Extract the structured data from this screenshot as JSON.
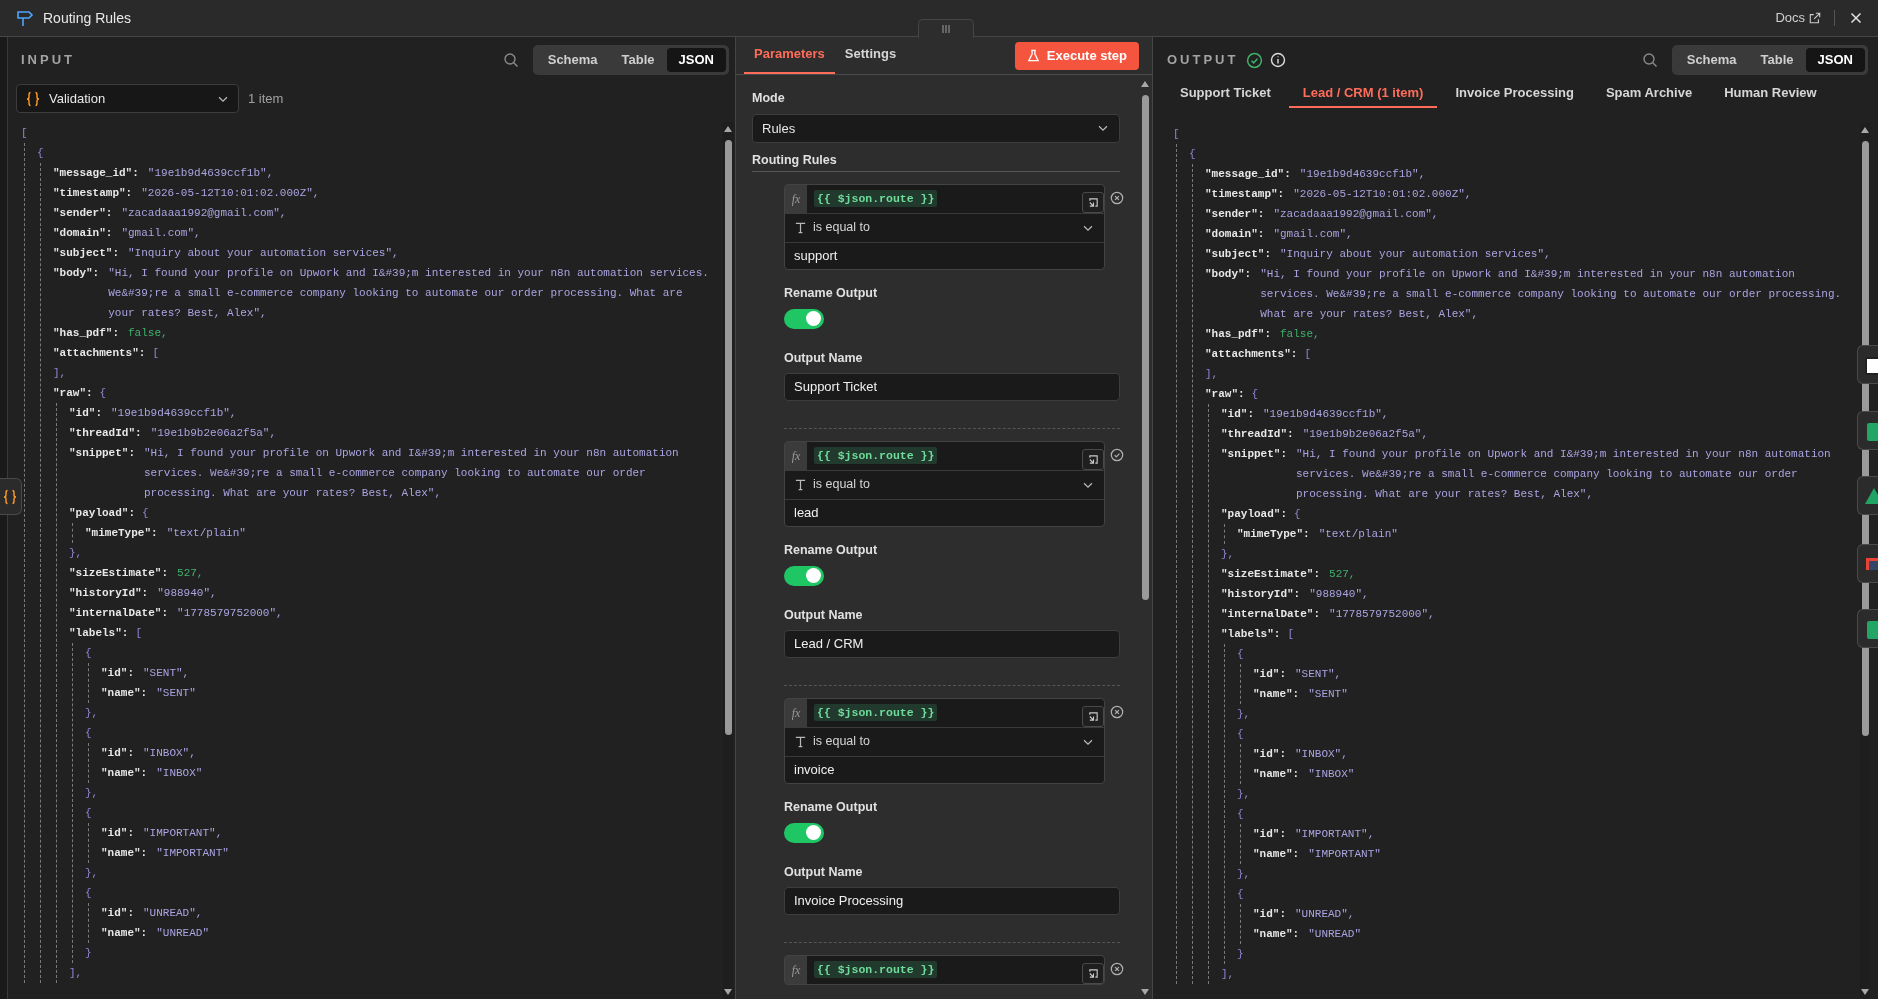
{
  "window": {
    "title": "Routing Rules",
    "docs_link": "Docs"
  },
  "input": {
    "label": "INPUT",
    "view_modes": [
      {
        "label": "Schema",
        "selected": false
      },
      {
        "label": "Table",
        "selected": false
      },
      {
        "label": "JSON",
        "selected": true
      }
    ],
    "source": "Validation",
    "item_count": "1 item",
    "json_tree": [
      {
        "open": "[",
        "children": [
          {
            "open": "{",
            "children": [
              {
                "key": "\"message_id\":",
                "value": "\"19e1b9d4639ccf1b\",",
                "kind": "string"
              },
              {
                "key": "\"timestamp\":",
                "value": "\"2026-05-12T10:01:02.000Z\",",
                "kind": "string"
              },
              {
                "key": "\"sender\":",
                "value": "\"zacadaaa1992@gmail.com\",",
                "kind": "string"
              },
              {
                "key": "\"domain\":",
                "value": "\"gmail.com\",",
                "kind": "string"
              },
              {
                "key": "\"subject\":",
                "value": "\"Inquiry about your automation services\",",
                "kind": "string"
              },
              {
                "key": "\"body\":",
                "value": "\"Hi, I found your profile on Upwork and I&#39;m interested in your n8n automation services. We&#39;re a small e-commerce company looking to automate our order processing. What are your rates? Best, Alex\",",
                "kind": "string"
              },
              {
                "key": "\"has_pdf\":",
                "value": "false,",
                "kind": "literal"
              },
              {
                "key": "\"attachments\":",
                "open": "[",
                "close": "],"
              },
              {
                "key": "\"raw\":",
                "open": "{",
                "children": [
                  {
                    "key": "\"id\":",
                    "value": "\"19e1b9d4639ccf1b\",",
                    "kind": "string"
                  },
                  {
                    "key": "\"threadId\":",
                    "value": "\"19e1b9b2e06a2f5a\",",
                    "kind": "string"
                  },
                  {
                    "key": "\"snippet\":",
                    "value": "\"Hi, I found your profile on Upwork and I&#39;m interested in your n8n automation services. We&#39;re a small e-commerce company looking to automate our order processing. What are your rates? Best, Alex\",",
                    "kind": "string"
                  },
                  {
                    "key": "\"payload\":",
                    "open": "{",
                    "children": [
                      {
                        "key": "\"mimeType\":",
                        "value": "\"text/plain\"",
                        "kind": "string"
                      }
                    ],
                    "close": "},"
                  },
                  {
                    "key": "\"sizeEstimate\":",
                    "value": "527,",
                    "kind": "literal"
                  },
                  {
                    "key": "\"historyId\":",
                    "value": "\"988940\",",
                    "kind": "string"
                  },
                  {
                    "key": "\"internalDate\":",
                    "value": "\"1778579752000\",",
                    "kind": "string"
                  },
                  {
                    "key": "\"labels\":",
                    "open": "[",
                    "children": [
                      {
                        "open": "{",
                        "children": [
                          {
                            "key": "\"id\":",
                            "value": "\"SENT\",",
                            "kind": "string"
                          },
                          {
                            "key": "\"name\":",
                            "value": "\"SENT\"",
                            "kind": "string"
                          }
                        ],
                        "close": "},"
                      },
                      {
                        "open": "{",
                        "children": [
                          {
                            "key": "\"id\":",
                            "value": "\"INBOX\",",
                            "kind": "string"
                          },
                          {
                            "key": "\"name\":",
                            "value": "\"INBOX\"",
                            "kind": "string"
                          }
                        ],
                        "close": "},"
                      },
                      {
                        "open": "{",
                        "children": [
                          {
                            "key": "\"id\":",
                            "value": "\"IMPORTANT\",",
                            "kind": "string"
                          },
                          {
                            "key": "\"name\":",
                            "value": "\"IMPORTANT\"",
                            "kind": "string"
                          }
                        ],
                        "close": "},"
                      },
                      {
                        "open": "{",
                        "children": [
                          {
                            "key": "\"id\":",
                            "value": "\"UNREAD\",",
                            "kind": "string"
                          },
                          {
                            "key": "\"name\":",
                            "value": "\"UNREAD\"",
                            "kind": "string"
                          }
                        ],
                        "close": "}"
                      }
                    ],
                    "close": "],"
                  }
                ]
              }
            ]
          }
        ]
      }
    ]
  },
  "parameters": {
    "tabs": [
      {
        "label": "Parameters",
        "selected": true
      },
      {
        "label": "Settings",
        "selected": false
      }
    ],
    "execute_button": "Execute step",
    "mode_label": "Mode",
    "mode": "Rules",
    "rules_heading": "Routing Rules",
    "rules": [
      {
        "fx": "fx",
        "expression": "{{ $json.route }}",
        "operator": "is equal to",
        "value": "support",
        "rename_label": "Rename Output",
        "rename_on": true,
        "output_name_label": "Output Name",
        "output_name": "Support Ticket",
        "kind": "remove"
      },
      {
        "fx": "fx",
        "expression": "{{ $json.route }}",
        "operator": "is equal to",
        "value": "lead",
        "rename_label": "Rename Output",
        "rename_on": true,
        "output_name_label": "Output Name",
        "output_name": "Lead / CRM",
        "kind": "confirm"
      },
      {
        "fx": "fx",
        "expression": "{{ $json.route }}",
        "operator": "is equal to",
        "value": "invoice",
        "rename_label": "Rename Output",
        "rename_on": true,
        "output_name_label": "Output Name",
        "output_name": "Invoice Processing",
        "kind": "remove"
      },
      {
        "fx": "fx",
        "expression": "{{ $json.route }}",
        "kind": "remove"
      }
    ]
  },
  "output": {
    "label": "OUTPUT",
    "success": true,
    "view_modes": [
      {
        "label": "Schema",
        "selected": false
      },
      {
        "label": "Table",
        "selected": false
      },
      {
        "label": "JSON",
        "selected": true
      }
    ],
    "branches": [
      {
        "label": "Support Ticket",
        "selected": false
      },
      {
        "label": "Lead / CRM (1 item)",
        "selected": true
      },
      {
        "label": "Invoice Processing",
        "selected": false
      },
      {
        "label": "Spam Archive",
        "selected": false
      },
      {
        "label": "Human Review",
        "selected": false
      }
    ],
    "json_tree": [
      {
        "open": "[",
        "children": [
          {
            "open": "{",
            "children": [
              {
                "key": "\"message_id\":",
                "value": "\"19e1b9d4639ccf1b\",",
                "kind": "string"
              },
              {
                "key": "\"timestamp\":",
                "value": "\"2026-05-12T10:01:02.000Z\",",
                "kind": "string"
              },
              {
                "key": "\"sender\":",
                "value": "\"zacadaaa1992@gmail.com\",",
                "kind": "string"
              },
              {
                "key": "\"domain\":",
                "value": "\"gmail.com\",",
                "kind": "string"
              },
              {
                "key": "\"subject\":",
                "value": "\"Inquiry about your automation services\",",
                "kind": "string"
              },
              {
                "key": "\"body\":",
                "value": "\"Hi, I found your profile on Upwork and I&#39;m interested in your n8n automation services. We&#39;re a small e-commerce company looking to automate our order processing. What are your rates? Best, Alex\",",
                "kind": "string"
              },
              {
                "key": "\"has_pdf\":",
                "value": "false,",
                "kind": "literal"
              },
              {
                "key": "\"attachments\":",
                "open": "[",
                "close": "],"
              },
              {
                "key": "\"raw\":",
                "open": "{",
                "children": [
                  {
                    "key": "\"id\":",
                    "value": "\"19e1b9d4639ccf1b\",",
                    "kind": "string"
                  },
                  {
                    "key": "\"threadId\":",
                    "value": "\"19e1b9b2e06a2f5a\",",
                    "kind": "string"
                  },
                  {
                    "key": "\"snippet\":",
                    "value": "\"Hi, I found your profile on Upwork and I&#39;m interested in your n8n automation services. We&#39;re a small e-commerce company looking to automate our order processing. What are your rates? Best, Alex\",",
                    "kind": "string"
                  },
                  {
                    "key": "\"payload\":",
                    "open": "{",
                    "children": [
                      {
                        "key": "\"mimeType\":",
                        "value": "\"text/plain\"",
                        "kind": "string"
                      }
                    ],
                    "close": "},"
                  },
                  {
                    "key": "\"sizeEstimate\":",
                    "value": "527,",
                    "kind": "literal"
                  },
                  {
                    "key": "\"historyId\":",
                    "value": "\"988940\",",
                    "kind": "string"
                  },
                  {
                    "key": "\"internalDate\":",
                    "value": "\"1778579752000\",",
                    "kind": "string"
                  },
                  {
                    "key": "\"labels\":",
                    "open": "[",
                    "children": [
                      {
                        "open": "{",
                        "children": [
                          {
                            "key": "\"id\":",
                            "value": "\"SENT\",",
                            "kind": "string"
                          },
                          {
                            "key": "\"name\":",
                            "value": "\"SENT\"",
                            "kind": "string"
                          }
                        ],
                        "close": "},"
                      },
                      {
                        "open": "{",
                        "children": [
                          {
                            "key": "\"id\":",
                            "value": "\"INBOX\",",
                            "kind": "string"
                          },
                          {
                            "key": "\"name\":",
                            "value": "\"INBOX\"",
                            "kind": "string"
                          }
                        ],
                        "close": "},"
                      },
                      {
                        "open": "{",
                        "children": [
                          {
                            "key": "\"id\":",
                            "value": "\"IMPORTANT\",",
                            "kind": "string"
                          },
                          {
                            "key": "\"name\":",
                            "value": "\"IMPORTANT\"",
                            "kind": "string"
                          }
                        ],
                        "close": "},"
                      },
                      {
                        "open": "{",
                        "children": [
                          {
                            "key": "\"id\":",
                            "value": "\"UNREAD\",",
                            "kind": "string"
                          },
                          {
                            "key": "\"name\":",
                            "value": "\"UNREAD\"",
                            "kind": "string"
                          }
                        ],
                        "close": "}"
                      }
                    ],
                    "close": "],"
                  }
                ]
              }
            ]
          }
        ]
      }
    ]
  }
}
